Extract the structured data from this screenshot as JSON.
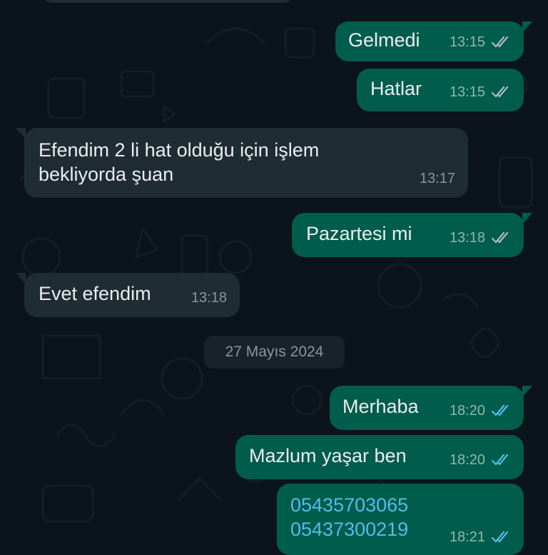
{
  "chat": {
    "date_separator": "27 Mayıs 2024",
    "messages": [
      {
        "id": "m1",
        "dir": "out",
        "text": "Gelmedi",
        "time": "13:15",
        "status": "read-grey"
      },
      {
        "id": "m2",
        "dir": "out",
        "text": "Hatlar",
        "time": "13:15",
        "status": "read-grey"
      },
      {
        "id": "m3",
        "dir": "in",
        "lines": [
          "Efendim 2 li hat olduğu için işlem",
          "bekliyorda şuan"
        ],
        "time": "13:17"
      },
      {
        "id": "m4",
        "dir": "out",
        "text": "Pazartesi mi",
        "time": "13:18",
        "status": "read-grey"
      },
      {
        "id": "m5",
        "dir": "in",
        "text": "Evet efendim",
        "time": "13:18"
      },
      {
        "id": "m6",
        "dir": "out",
        "text": "Merhaba",
        "time": "18:20",
        "status": "read-blue"
      },
      {
        "id": "m7",
        "dir": "out",
        "text": "Mazlum yaşar ben",
        "time": "18:20",
        "status": "read-blue"
      },
      {
        "id": "m8",
        "dir": "out",
        "lines": [
          "05435703065",
          "05437300219"
        ],
        "time": "18:21",
        "status": "read-blue"
      }
    ]
  },
  "colors": {
    "background": "#0b141a",
    "outgoing_bubble": "#005c4b",
    "incoming_bubble": "#202c33",
    "read_tick_blue": "#53bdeb",
    "read_tick_grey": "#aebac1",
    "phone_link": "#53bdeb"
  },
  "icons": {
    "double_check": "double-check-icon"
  }
}
